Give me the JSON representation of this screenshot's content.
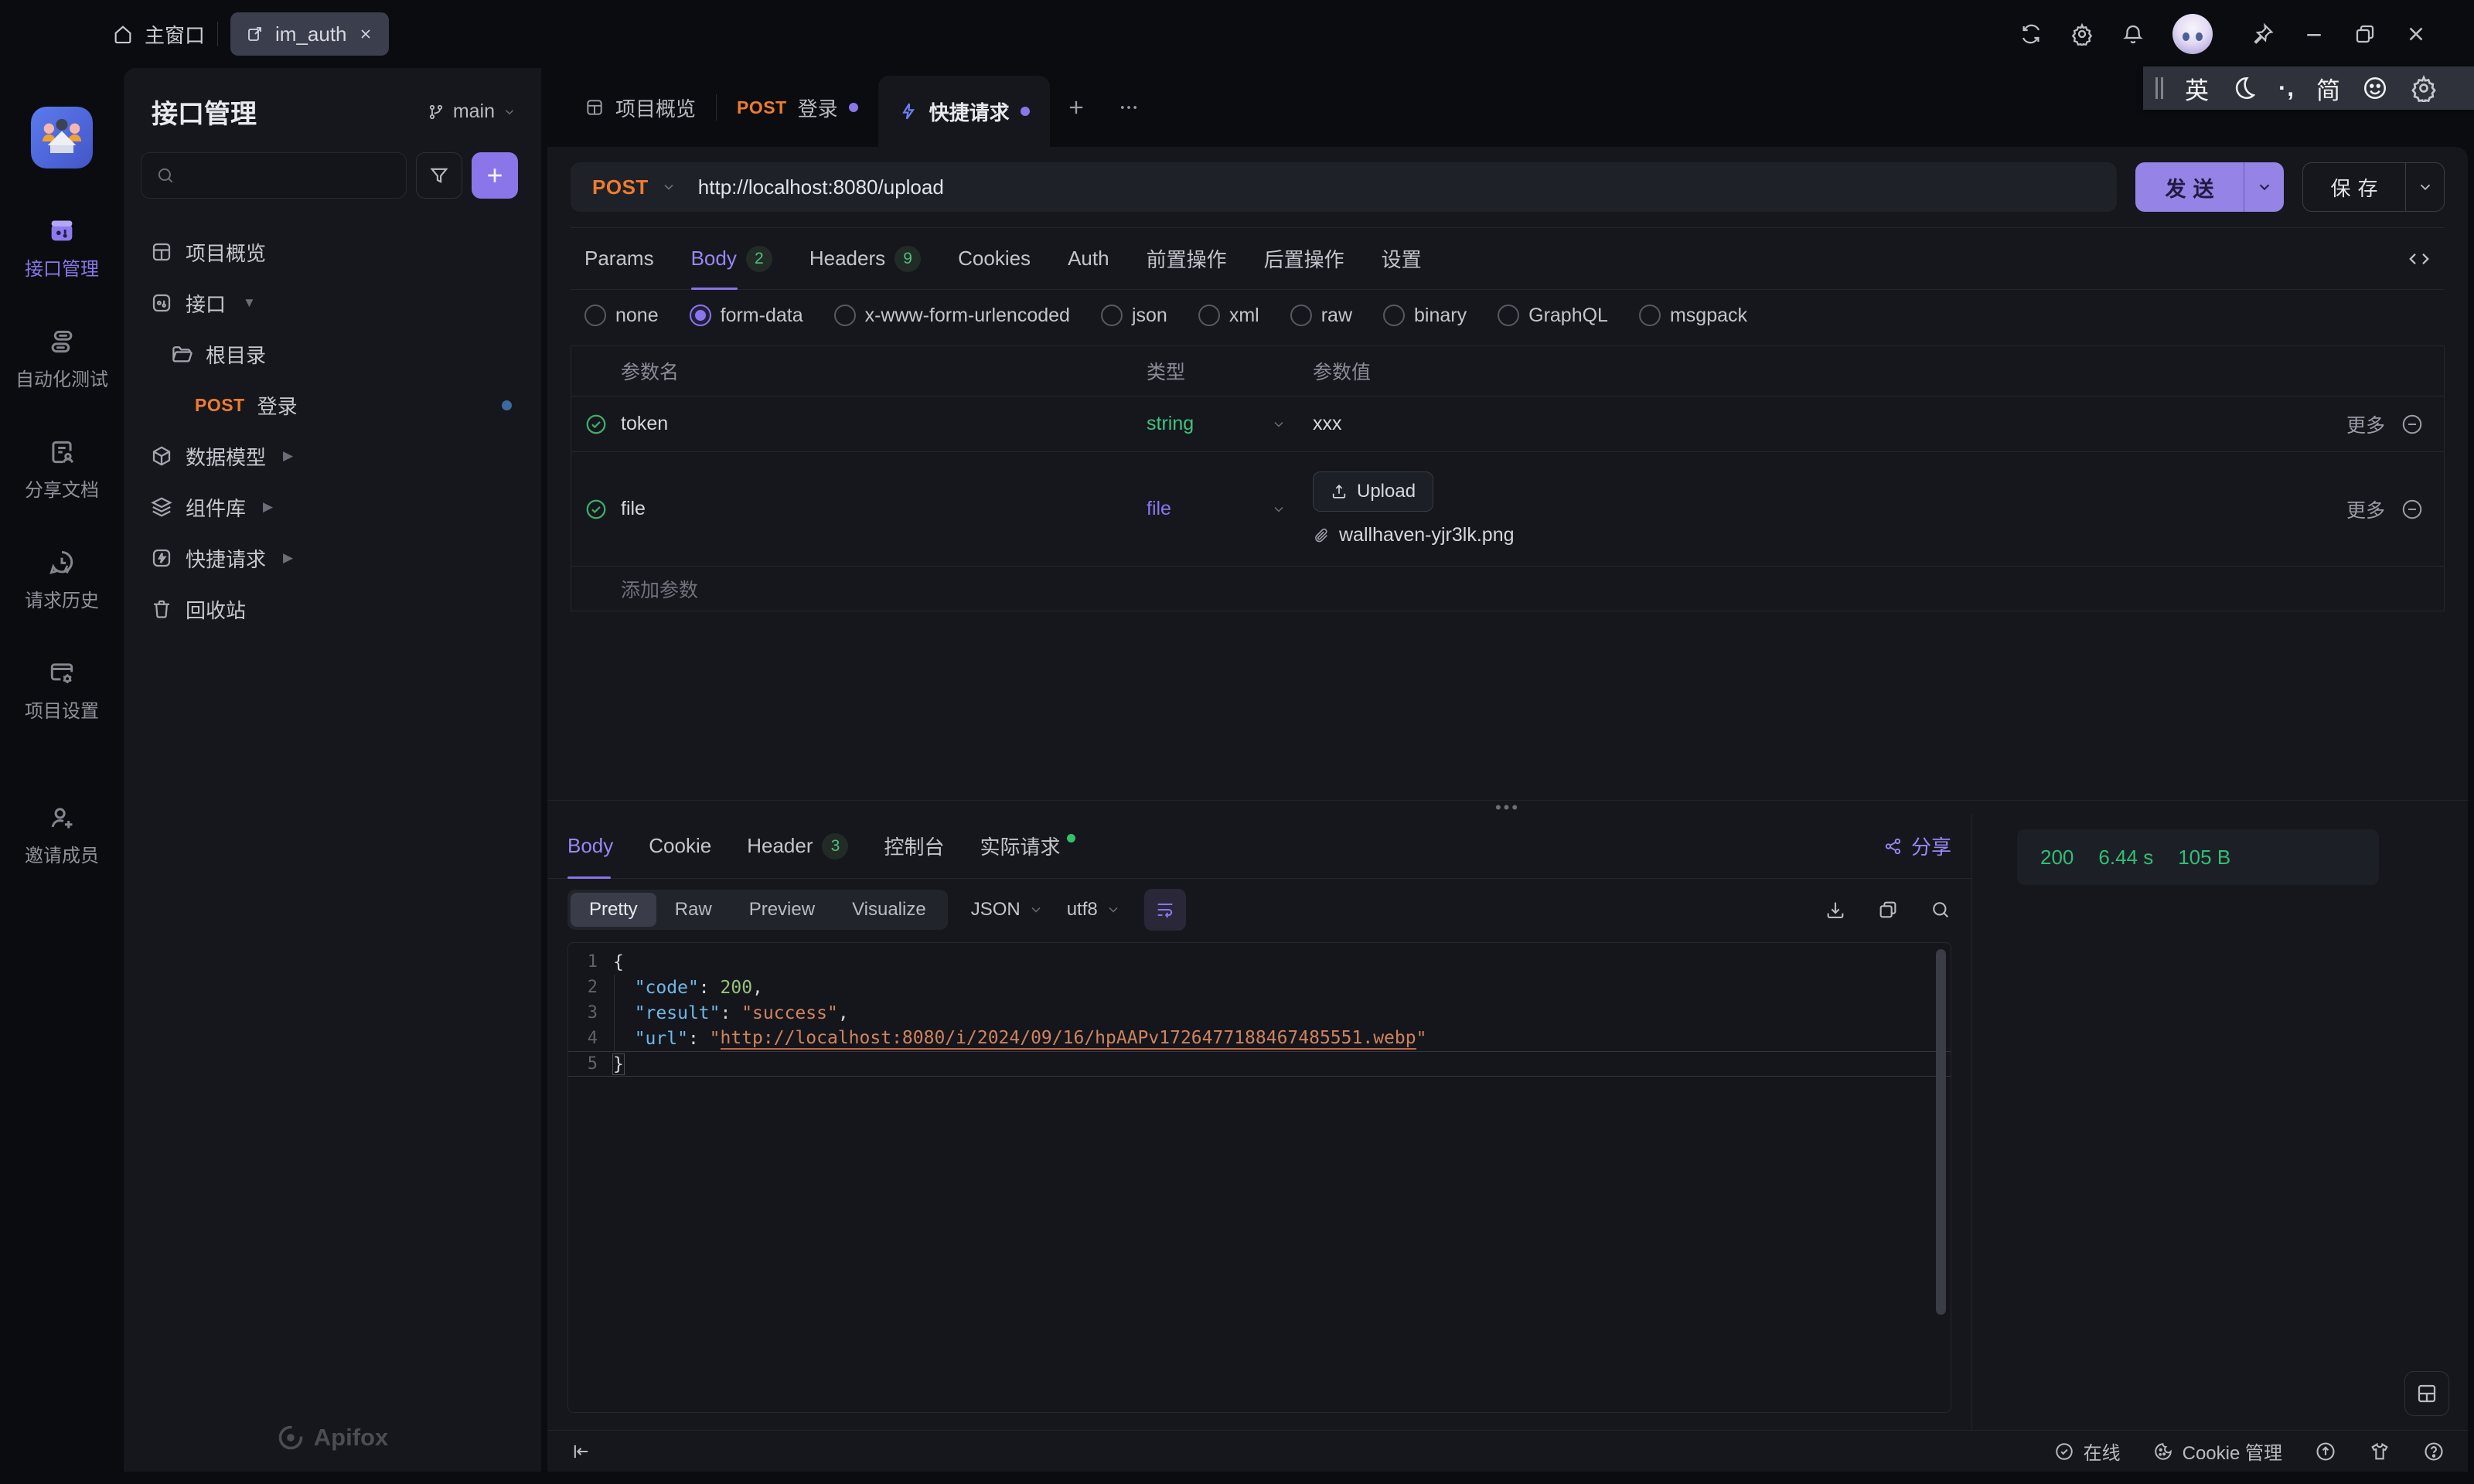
{
  "titlebar": {
    "home_label": "主窗口",
    "tab_label": "im_auth"
  },
  "ime": {
    "lang": "英",
    "punct": "·,",
    "mode": "简"
  },
  "rail": {
    "items": [
      {
        "label": "接口管理"
      },
      {
        "label": "自动化测试"
      },
      {
        "label": "分享文档"
      },
      {
        "label": "请求历史"
      },
      {
        "label": "项目设置"
      },
      {
        "label": "邀请成员"
      }
    ]
  },
  "sidebar": {
    "title": "接口管理",
    "branch": "main",
    "tree": {
      "overview": "项目概览",
      "api_group": "接口",
      "root_folder": "根目录",
      "login_method": "POST",
      "login_label": "登录",
      "models": "数据模型",
      "components": "组件库",
      "quick_request": "快捷请求",
      "trash": "回收站"
    },
    "logo": "Apifox"
  },
  "doc_tabs": {
    "overview": "项目概览",
    "login_method": "POST",
    "login_label": "登录",
    "quick_label": "快捷请求"
  },
  "request": {
    "method": "POST",
    "url": "http://localhost:8080/upload",
    "send": "发送",
    "save": "保存",
    "tabs": [
      {
        "label": "Params"
      },
      {
        "label": "Body",
        "badge": "2"
      },
      {
        "label": "Headers",
        "badge": "9"
      },
      {
        "label": "Cookies"
      },
      {
        "label": "Auth"
      },
      {
        "label": "前置操作"
      },
      {
        "label": "后置操作"
      },
      {
        "label": "设置"
      }
    ],
    "body_types": [
      "none",
      "form-data",
      "x-www-form-urlencoded",
      "json",
      "xml",
      "raw",
      "binary",
      "GraphQL",
      "msgpack"
    ],
    "selected_body_type": "form-data",
    "table": {
      "col_name": "参数名",
      "col_type": "类型",
      "col_value": "参数值",
      "rows": [
        {
          "name": "token",
          "type": "string",
          "value": "xxx",
          "more": "更多"
        },
        {
          "name": "file",
          "type": "file",
          "upload": "Upload",
          "file_name": "wallhaven-yjr3lk.png",
          "more": "更多"
        }
      ],
      "add_label": "添加参数"
    }
  },
  "response": {
    "tabs": [
      {
        "label": "Body"
      },
      {
        "label": "Cookie"
      },
      {
        "label": "Header",
        "badge": "3"
      },
      {
        "label": "控制台"
      },
      {
        "label": "实际请求"
      }
    ],
    "share": "分享",
    "status": {
      "code": "200",
      "time": "6.44 s",
      "size": "105 B"
    },
    "modes": [
      "Pretty",
      "Raw",
      "Preview",
      "Visualize"
    ],
    "selected_mode": "Pretty",
    "format": "JSON",
    "encoding": "utf8",
    "code": {
      "active_line": 5,
      "lines": [
        [
          {
            "t": "{",
            "c": "p"
          }
        ],
        [
          {
            "t": "  ",
            "c": "p"
          },
          {
            "t": "\"code\"",
            "c": "k"
          },
          {
            "t": ": ",
            "c": "p"
          },
          {
            "t": "200",
            "c": "n"
          },
          {
            "t": ",",
            "c": "p"
          }
        ],
        [
          {
            "t": "  ",
            "c": "p"
          },
          {
            "t": "\"result\"",
            "c": "k"
          },
          {
            "t": ": ",
            "c": "p"
          },
          {
            "t": "\"success\"",
            "c": "s"
          },
          {
            "t": ",",
            "c": "p"
          }
        ],
        [
          {
            "t": "  ",
            "c": "p"
          },
          {
            "t": "\"url\"",
            "c": "k"
          },
          {
            "t": ": ",
            "c": "p"
          },
          {
            "t": "\"",
            "c": "s"
          },
          {
            "t": "http://localhost:8080/i/2024/09/16/hpAAPv1726477188467485551.webp",
            "c": "u"
          },
          {
            "t": "\"",
            "c": "s"
          }
        ],
        [
          {
            "t": "}",
            "c": "b"
          }
        ]
      ]
    }
  },
  "statusbar": {
    "online": "在线",
    "cookie": "Cookie 管理"
  }
}
